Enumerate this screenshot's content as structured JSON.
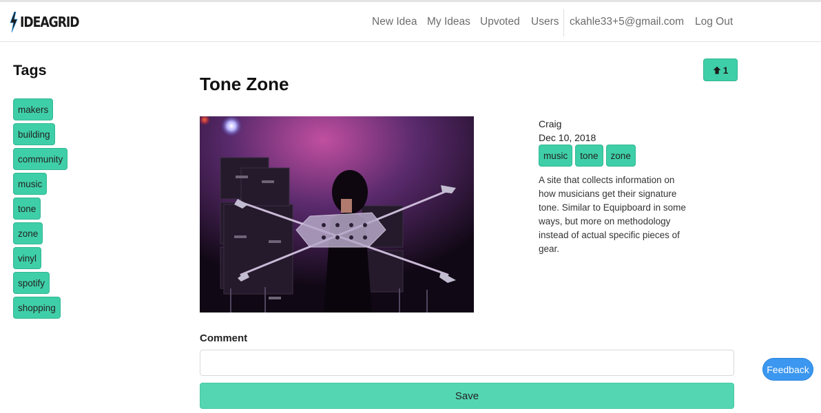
{
  "brand": {
    "name": "IDEAGRID"
  },
  "nav": {
    "new_idea": "New Idea",
    "my_ideas": "My Ideas",
    "upvoted": "Upvoted",
    "users": "Users",
    "email": "ckahle33+5@gmail.com",
    "logout": "Log Out"
  },
  "sidebar": {
    "title": "Tags",
    "tags": [
      "makers",
      "building",
      "community",
      "music",
      "tone",
      "zone",
      "vinyl",
      "spotify",
      "shopping"
    ]
  },
  "idea": {
    "title": "Tone Zone",
    "upvotes": "1",
    "author": "Craig",
    "date": "Dec 10, 2018",
    "tags": [
      "music",
      "tone",
      "zone"
    ],
    "description": "A site that collects information on how musicians get their signature tone. Similar to Equipboard in some ways, but more on methodology instead of actual specific pieces of gear."
  },
  "comment": {
    "label": "Comment",
    "value": "",
    "save_label": "Save"
  },
  "feedback": {
    "label": "Feedback"
  },
  "colors": {
    "accent": "#3fcfa8",
    "accent_border": "#2fb792",
    "save": "#55d6b3",
    "feedback": "#3b97ef"
  }
}
